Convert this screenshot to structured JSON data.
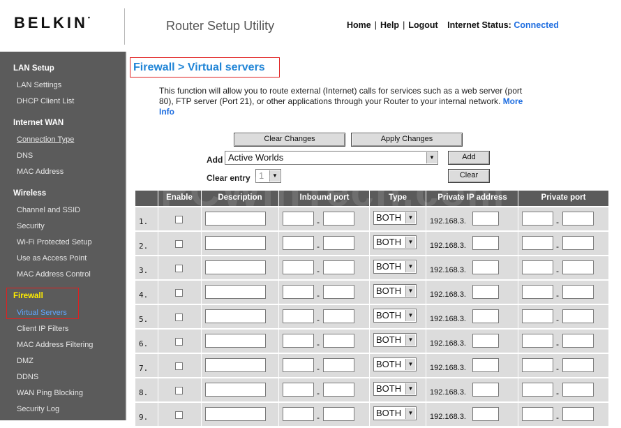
{
  "header": {
    "logo": "BELKIN",
    "logo_mark": "•",
    "app_title": "Router Setup Utility",
    "nav": {
      "home": "Home",
      "help": "Help",
      "logout": "Logout",
      "sep": "|"
    },
    "status_label": "Internet Status:",
    "status_value": "Connected",
    "status_color": "#1f6ee0"
  },
  "sidebar": {
    "sections": [
      {
        "title": "LAN Setup",
        "items": [
          "LAN Settings",
          "DHCP Client List"
        ]
      },
      {
        "title": "Internet WAN",
        "items": [
          "Connection Type",
          "DNS",
          "MAC Address"
        ]
      },
      {
        "title": "Wireless",
        "items": [
          "Channel and SSID",
          "Security",
          "Wi-Fi Protected Setup",
          "Use as Access Point",
          "MAC Address Control"
        ]
      },
      {
        "title": "Firewall",
        "items": [
          "Virtual Servers",
          "Client IP Filters",
          "MAC Address Filtering",
          "DMZ",
          "DDNS",
          "WAN Ping Blocking",
          "Security Log"
        ]
      }
    ],
    "active_section": "Firewall",
    "active_item": "Virtual Servers",
    "active_section_color": "#ffee00",
    "active_item_color": "#5fa6ff"
  },
  "main": {
    "title": "Firewall > Virtual servers",
    "intro": "This function will allow you to route external (Internet) calls for services such as a web server (port 80), FTP server (Port 21), or other applications through your Router to your internal network.",
    "more_info": "More Info",
    "buttons": {
      "clear_changes": "Clear Changes",
      "apply_changes": "Apply Changes",
      "add": "Add",
      "clear": "Clear"
    },
    "add_label": "Add",
    "add_selected": "Active Worlds",
    "clear_label": "Clear entry",
    "clear_selected": "1",
    "table": {
      "headers": [
        "Enable",
        "Description",
        "Inbound port",
        "Type",
        "Private IP address",
        "Private port"
      ],
      "rows": [
        {
          "num": "1.",
          "type": "BOTH",
          "ip_prefix": "192.168.3."
        },
        {
          "num": "2.",
          "type": "BOTH",
          "ip_prefix": "192.168.3."
        },
        {
          "num": "3.",
          "type": "BOTH",
          "ip_prefix": "192.168.3."
        },
        {
          "num": "4.",
          "type": "BOTH",
          "ip_prefix": "192.168.3."
        },
        {
          "num": "5.",
          "type": "BOTH",
          "ip_prefix": "192.168.3."
        },
        {
          "num": "6.",
          "type": "BOTH",
          "ip_prefix": "192.168.3."
        },
        {
          "num": "7.",
          "type": "BOTH",
          "ip_prefix": "192.168.3."
        },
        {
          "num": "8.",
          "type": "BOTH",
          "ip_prefix": "192.168.3."
        },
        {
          "num": "9.",
          "type": "BOTH",
          "ip_prefix": "192.168.3."
        }
      ]
    }
  },
  "watermark": "PCWinTech.com"
}
